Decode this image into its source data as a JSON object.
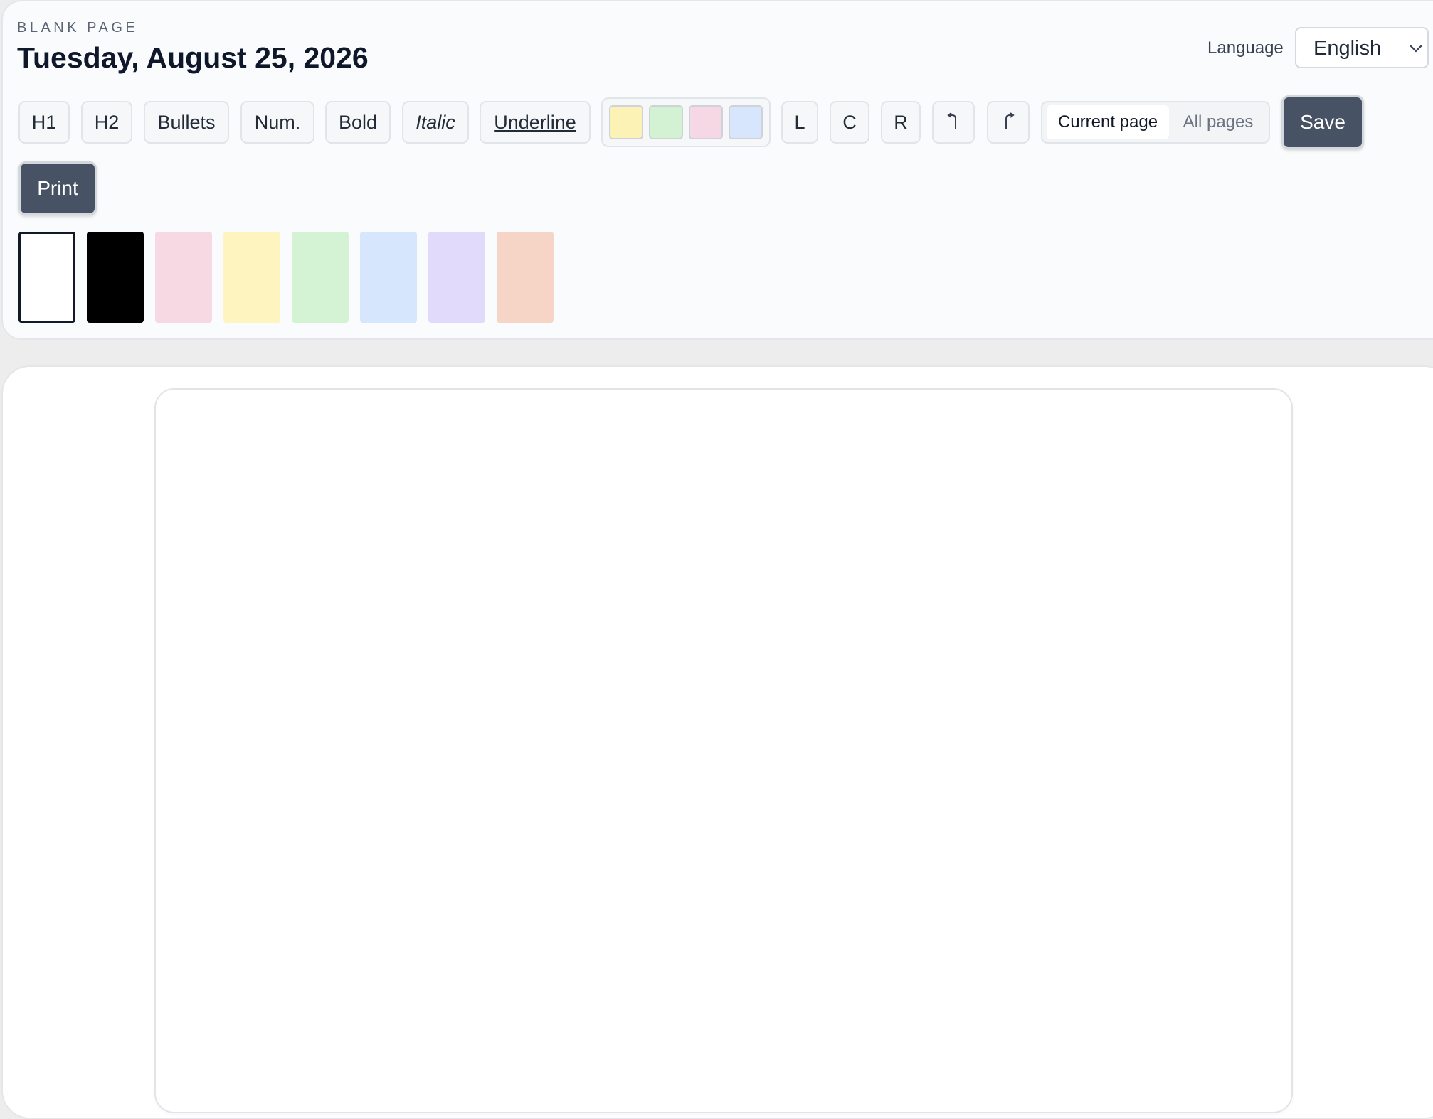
{
  "header": {
    "eyebrow": "BLANK PAGE",
    "date": "Tuesday, August 25, 2026",
    "language_label": "Language",
    "language_value": "English"
  },
  "toolbar": {
    "h1": "H1",
    "h2": "H2",
    "bullets": "Bullets",
    "numbered": "Num.",
    "bold": "Bold",
    "italic": "Italic",
    "underline": "Underline",
    "highlight_colors": [
      "#fdf2b5",
      "#d3f2d3",
      "#f5d8e3",
      "#d7e6fd"
    ],
    "align_left": "L",
    "align_center": "C",
    "align_right": "R",
    "undo_icon": "undo-icon",
    "redo_icon": "redo-icon",
    "scope_current": "Current page",
    "scope_all": "All pages",
    "scope_selected": "Current page",
    "save": "Save",
    "print": "Print"
  },
  "background_colors": {
    "selected": "#ffffff",
    "options": [
      "#ffffff",
      "#000000",
      "#f6d9e3",
      "#fdf4bf",
      "#d4f3d4",
      "#d6e6fd",
      "#e1dafa",
      "#f7d5c6"
    ]
  },
  "colors": {
    "accent_dark": "#475264",
    "panel_bg": "#fafbfc",
    "page_bg": "#ededee"
  }
}
